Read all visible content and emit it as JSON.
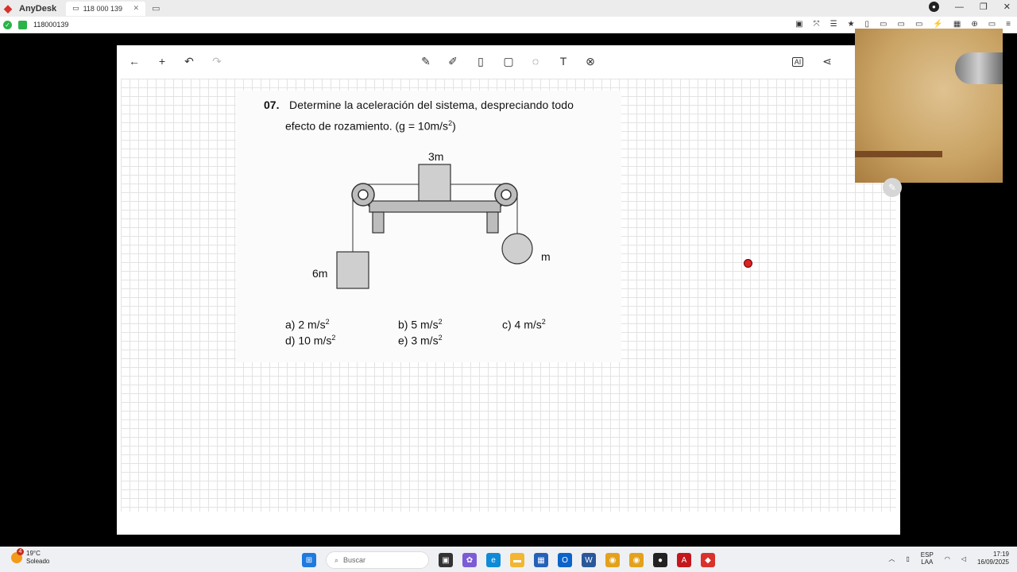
{
  "anydesk": {
    "app_name": "AnyDesk",
    "tab_label": "118 000 139",
    "address": "118000139"
  },
  "whiteboard": {
    "toolbar": {
      "back": "←",
      "add": "+",
      "undo": "↶",
      "redo": "↷",
      "pen": "✎",
      "marker": "✐",
      "eraser": "▯",
      "shape": "▢",
      "lasso": "◌",
      "text": "T",
      "clear": "⊗",
      "ai": "AI",
      "share": "⋖"
    },
    "problem": {
      "number": "07.",
      "text_line1": "Determine la aceleración del sistema, despreciando todo",
      "text_line2_prefix": "efecto de rozamiento. (g = 10m/s",
      "text_line2_exp": "2",
      "text_line2_suffix": ")",
      "diagram": {
        "label_top": "3m",
        "label_left": "6m",
        "label_right": "m"
      },
      "answers": [
        {
          "label": "a) 2 m/s",
          "exp": "2"
        },
        {
          "label": "b) 5 m/s",
          "exp": "2"
        },
        {
          "label": "c) 4 m/s",
          "exp": "2"
        },
        {
          "label": "d) 10 m/s",
          "exp": "2"
        },
        {
          "label": "e) 3 m/s",
          "exp": "2"
        }
      ]
    }
  },
  "taskbar": {
    "weather_temp": "19°C",
    "weather_desc": "Soleado",
    "weather_badge": "4",
    "search_placeholder": "Buscar",
    "lang_1": "ESP",
    "lang_2": "LAA",
    "time": "17:19",
    "date": "16/09/2025"
  },
  "colors": {
    "anydesk_red": "#d9312b",
    "ok_green": "#2bb34a",
    "grid_line": "#e3e3e3"
  }
}
